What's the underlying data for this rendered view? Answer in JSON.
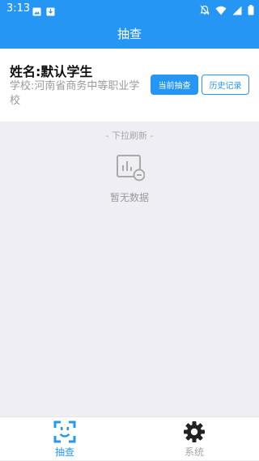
{
  "status_bar": {
    "time": "3:13",
    "icons": [
      "image-icon",
      "download-icon",
      "bell-off-icon",
      "wifi-icon",
      "signal-icon",
      "battery-icon"
    ]
  },
  "app_bar": {
    "title": "抽查"
  },
  "student": {
    "name": "姓名:默认学生",
    "school": "学校:河南省商务中等职业学校"
  },
  "actions": {
    "current_check": "当前抽查",
    "history": "历史记录"
  },
  "content": {
    "pull_hint": "- 下拉刷新 -",
    "empty_text": "暂无数据",
    "empty_icon": "chart-empty-icon"
  },
  "bottom_nav": {
    "items": [
      {
        "label": "抽查",
        "icon": "scan-face-icon",
        "active": true
      },
      {
        "label": "系统",
        "icon": "gear-icon",
        "active": false
      }
    ]
  },
  "colors": {
    "primary": "#2596f3",
    "background": "#efeff3",
    "muted_text": "#9a9a9a"
  }
}
